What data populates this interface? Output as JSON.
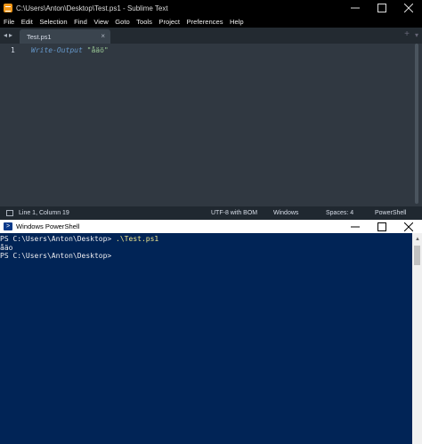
{
  "sublime": {
    "title": "C:\\Users\\Anton\\Desktop\\Test.ps1 - Sublime Text",
    "menu": [
      "File",
      "Edit",
      "Selection",
      "Find",
      "View",
      "Goto",
      "Tools",
      "Project",
      "Preferences",
      "Help"
    ],
    "tab": {
      "label": "Test.ps1",
      "close": "×"
    },
    "tab_plus": "+",
    "tab_overflow": "▾",
    "nav_arrows": "◂▸",
    "editor": {
      "line_number": "1",
      "code_keyword": "Write-Output",
      "code_string": "\"åäö\""
    },
    "status": {
      "position": "Line 1, Column 19",
      "encoding": "UTF-8 with BOM",
      "line_endings": "Windows",
      "indent": "Spaces: 4",
      "syntax": "PowerShell"
    }
  },
  "powershell": {
    "title": "Windows PowerShell",
    "lines": [
      {
        "prompt": "PS C:\\Users\\Anton\\Desktop> ",
        "command": ".\\Test.ps1"
      },
      {
        "output": "åäo"
      },
      {
        "prompt": "PS C:\\Users\\Anton\\Desktop>",
        "command": ""
      }
    ]
  }
}
